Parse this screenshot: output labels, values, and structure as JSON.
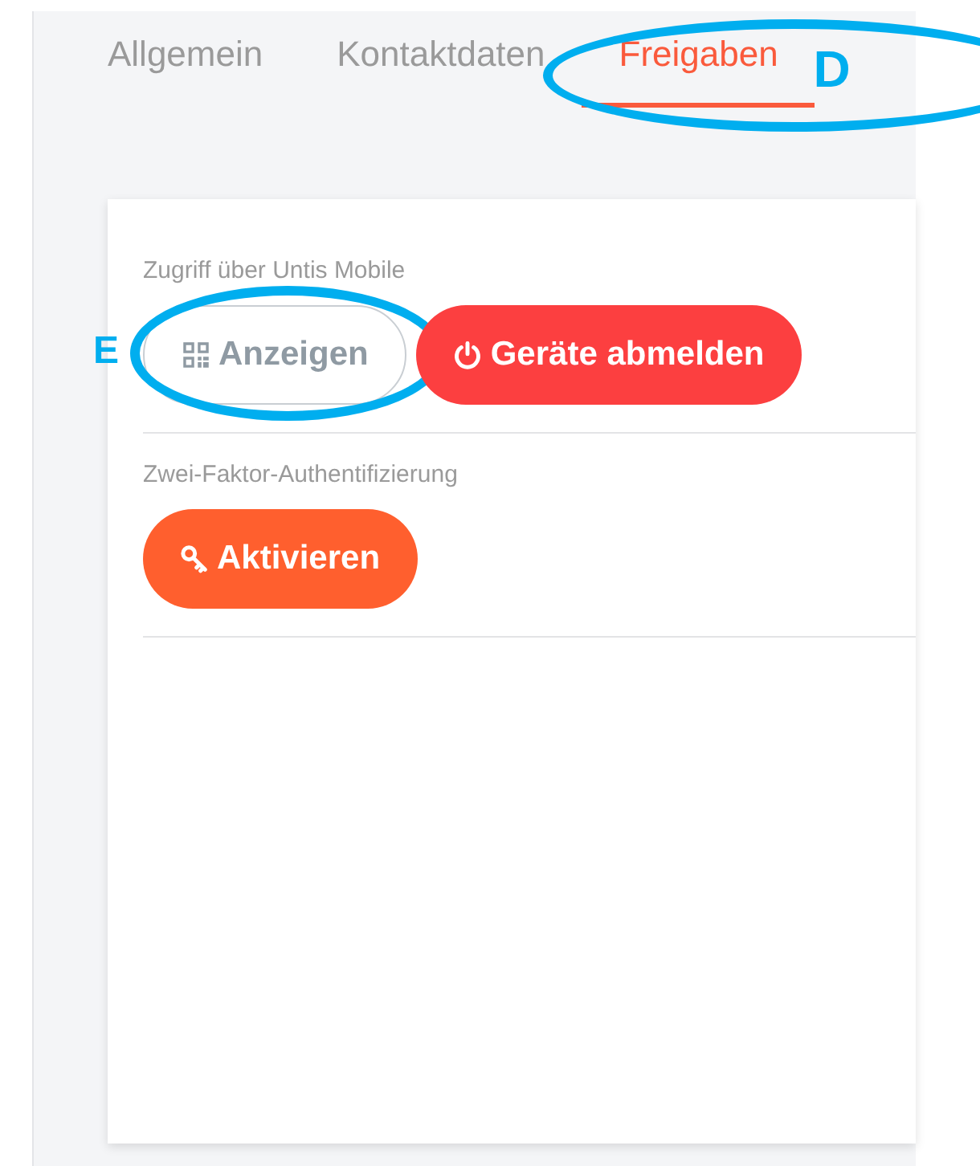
{
  "tabs": [
    {
      "label": "Allgemein",
      "selected": false
    },
    {
      "label": "Kontaktdaten",
      "selected": false
    },
    {
      "label": "Freigaben",
      "selected": true,
      "annotation": "D"
    }
  ],
  "sections": [
    {
      "label": "Zugriff über Untis Mobile",
      "buttons": [
        {
          "label": "Anzeigen",
          "kind": "outline",
          "annotation": "E"
        },
        {
          "label": "Geräte abmelden",
          "kind": "danger"
        }
      ]
    },
    {
      "label": "Zwei-Faktor-Authentifizierung",
      "buttons": [
        {
          "label": "Aktivieren",
          "kind": "warning"
        }
      ]
    }
  ]
}
